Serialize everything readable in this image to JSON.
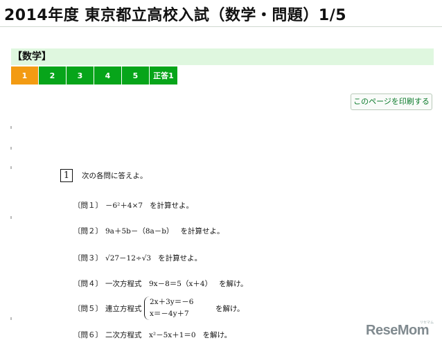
{
  "header": {
    "title": "2014年度 東京都立高校入試（数学・問題）1/5"
  },
  "section": {
    "label": "【数学】"
  },
  "tabs": [
    {
      "label": "1",
      "active": true
    },
    {
      "label": "2",
      "active": false
    },
    {
      "label": "3",
      "active": false
    },
    {
      "label": "4",
      "active": false
    },
    {
      "label": "5",
      "active": false
    },
    {
      "label": "正答1",
      "active": false
    }
  ],
  "print_button": {
    "label": "このページを印刷する"
  },
  "problem": {
    "number": "1",
    "intro": "次の各問に答えよ。",
    "questions": [
      {
        "label": "〔問１〕",
        "expr": "－6²＋4×7",
        "tail": "を計算せよ。"
      },
      {
        "label": "〔問２〕",
        "expr": "9a＋5b－（8a－b）",
        "tail": "を計算せよ。"
      },
      {
        "label": "〔問３〕",
        "expr": "√27－12÷√3",
        "tail": "を計算せよ。"
      },
      {
        "label": "〔問４〕",
        "expr": "一次方程式　9x－8＝5（x＋4）",
        "tail": "を解け。"
      },
      {
        "label": "〔問５〕",
        "expr": "連立方程式",
        "tail": ""
      },
      {
        "label": "〔問６〕",
        "expr": "二次方程式　x²－5x＋1＝0",
        "tail": "を解け。"
      }
    ],
    "system": {
      "line1": "2x＋3y＝－6",
      "line2": "x＝－4y＋7",
      "tail": "を解け。"
    }
  },
  "logo": {
    "text": "ReseMom",
    "ruby": "リセマム"
  },
  "colors": {
    "tab": "#07a51a",
    "tab_active": "#f39b12",
    "section_bg": "#dff7df"
  }
}
